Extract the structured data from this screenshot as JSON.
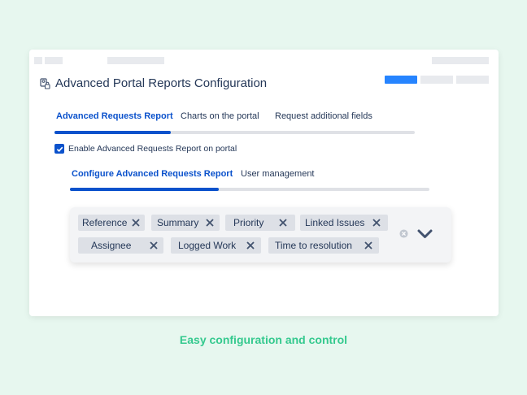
{
  "page": {
    "title": "Advanced Portal Reports Configuration"
  },
  "main_tabs": [
    {
      "label": "Advanced Requests Report",
      "active": true
    },
    {
      "label": "Charts on the portal",
      "active": false
    },
    {
      "label": "Request additional fields",
      "active": false
    }
  ],
  "enable_checkbox": {
    "label": "Enable Advanced Requests Report on portal",
    "checked": true
  },
  "sub_tabs": [
    {
      "label": "Configure Advanced Requests Report",
      "active": true
    },
    {
      "label": "User management",
      "active": false
    }
  ],
  "columns_select": {
    "chips": [
      {
        "label": "Reference"
      },
      {
        "label": "Summary"
      },
      {
        "label": "Priority"
      },
      {
        "label": "Linked Issues"
      },
      {
        "label": "Assignee"
      },
      {
        "label": "Logged Work"
      },
      {
        "label": "Time to resolution"
      }
    ],
    "icons": {
      "remove": "close-icon",
      "clear": "clear-circle-icon",
      "dropdown": "chevron-down-icon"
    }
  },
  "tagline": "Easy configuration and control",
  "colors": {
    "background": "#e7f7ef",
    "accent": "#0b52cc",
    "primary_button": "#2684ff",
    "tagline": "#34c98e",
    "text": "#253858",
    "chip": "#dde0e6"
  }
}
